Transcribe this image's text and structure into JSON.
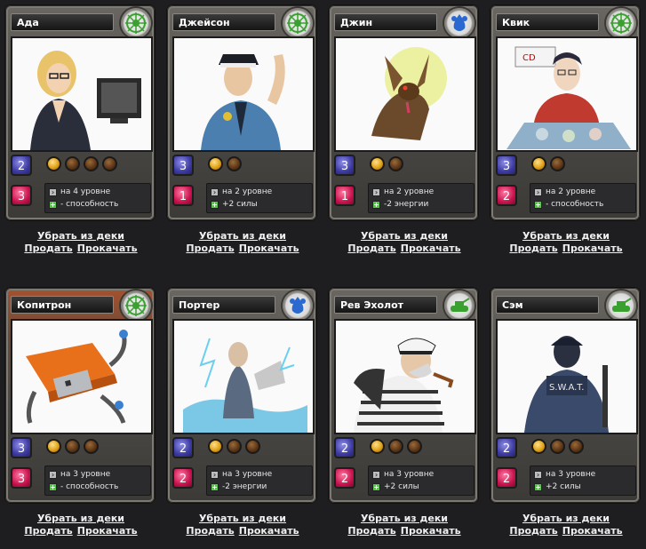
{
  "cards": [
    {
      "name": "Ада",
      "faction": "green-tech",
      "cost": "2",
      "power": "3",
      "slots_full": 1,
      "slots_total": 4,
      "line1": "на 4 уровне",
      "line2": "- способность",
      "frame": "gray",
      "portrait_icon": "woman-at-computer"
    },
    {
      "name": "Джейсон",
      "faction": "green-tech",
      "cost": "3",
      "power": "1",
      "slots_full": 1,
      "slots_total": 2,
      "line1": "на 2 уровне",
      "line2": "+2 силы",
      "frame": "gray",
      "portrait_icon": "police-officer"
    },
    {
      "name": "Джин",
      "faction": "blue-drop",
      "cost": "3",
      "power": "1",
      "slots_full": 1,
      "slots_total": 2,
      "line1": "на 2 уровне",
      "line2": "-2 энергии",
      "frame": "gray",
      "portrait_icon": "glowing-dog"
    },
    {
      "name": "Квик",
      "faction": "green-tech",
      "cost": "3",
      "power": "2",
      "slots_full": 1,
      "slots_total": 2,
      "line1": "на 2 уровне",
      "line2": "- способность",
      "frame": "gray",
      "portrait_icon": "man-with-cds"
    },
    {
      "name": "Копитрон",
      "faction": "green-tech",
      "cost": "3",
      "power": "3",
      "slots_full": 1,
      "slots_total": 3,
      "line1": "на 3 уровне",
      "line2": "- способность",
      "frame": "orange",
      "portrait_icon": "usb-robot"
    },
    {
      "name": "Портер",
      "faction": "blue-drop",
      "cost": "2",
      "power": "2",
      "slots_full": 1,
      "slots_total": 3,
      "line1": "на 3 уровне",
      "line2": "-2 энергии",
      "frame": "gray",
      "portrait_icon": "electric-man"
    },
    {
      "name": "Рев Эхолот",
      "faction": "green-tank",
      "cost": "2",
      "power": "2",
      "slots_full": 1,
      "slots_total": 3,
      "line1": "на 3 уровне",
      "line2": "+2 силы",
      "frame": "gray",
      "portrait_icon": "old-sailor"
    },
    {
      "name": "Сэм",
      "faction": "green-tank",
      "cost": "2",
      "power": "2",
      "slots_full": 1,
      "slots_total": 3,
      "line1": "на 3 уровне",
      "line2": "+2 силы",
      "frame": "gray",
      "portrait_icon": "swat-officer"
    }
  ],
  "actions": {
    "remove_label": "Убрать из деки",
    "sell_label": "Продать",
    "upgrade_label": "Прокачать"
  },
  "colors": {
    "background": "#1e1e21",
    "cost_gem": "#3c3aa0",
    "power_gem": "#c8124e",
    "energy_full": "#e0a21a",
    "energy_empty": "#5a3415",
    "frame_orange": "#a5522d"
  }
}
